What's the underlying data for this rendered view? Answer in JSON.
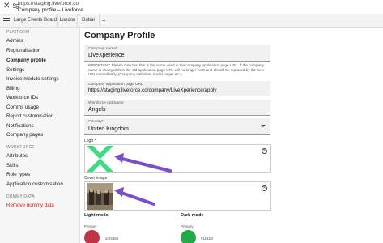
{
  "browser": {
    "url": "https://staging.liveforce.co",
    "title": "Company profile – Liveforce",
    "tabs": [
      "Large Events Board",
      "London",
      "Dubai"
    ],
    "new_tab": "+"
  },
  "sidebar": {
    "sections": [
      {
        "label": "PLATFORM"
      },
      {
        "label": "WORKFORCE"
      },
      {
        "label": "DUMMY DATA"
      }
    ],
    "platform_items": [
      "Admins",
      "Regionalisation",
      "Company profile",
      "Settings",
      "Invoice module settings",
      "Billing",
      "Workforce IDs",
      "Comms usage",
      "Report customisation",
      "Notifications",
      "Company pages"
    ],
    "workforce_items": [
      "Attributes",
      "Skills",
      "Role types",
      "Application customisation"
    ],
    "dummy_items": [
      "Remove dummy data"
    ]
  },
  "main": {
    "title": "Company Profile",
    "company_name": {
      "label": "Company name*",
      "value": "LiveXperience"
    },
    "note": "IMPORTANT: Please note that this is the name used in the company application page URL. If the company name is changed then the old application page URL will no longer work and should be replaced by the new URL immediately. (Company websites, social pages etc.)",
    "app_url": {
      "label": "Company application page URL",
      "value": "https://staging.liveforce.co/company/LiveXperience/apply"
    },
    "nickname": {
      "label": "Workforce nickname",
      "value": "Angels"
    },
    "country": {
      "label": "Country*",
      "value": "United Kingdom"
    },
    "logo_label": "Logo *",
    "cover_label": "Cover image",
    "light_mode": {
      "title": "Light mode",
      "primary_label": "Primary",
      "primary_hex": "d4f4d59",
      "color": "#c0344a"
    },
    "dark_mode": {
      "title": "Dark mode",
      "primary_label": "Primary",
      "primary_hex": "#1b1b0",
      "color": "#22aa44"
    },
    "logo_color": "#3ddc84",
    "arrow_color": "#7b4fc9"
  }
}
